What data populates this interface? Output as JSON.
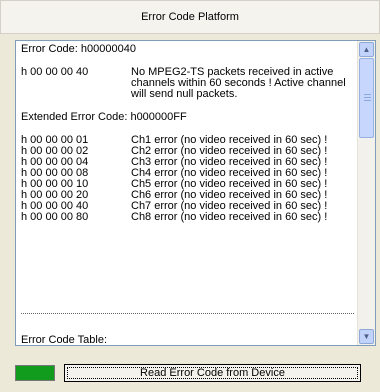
{
  "window": {
    "title": "Error Code Platform"
  },
  "output": {
    "error_code_line": "Error Code: h00000040",
    "main_code": {
      "code": "h 00 00 00 40",
      "message": [
        "No MPEG2-TS packets received in active",
        "channels within 60 seconds ! Active channel",
        "will send null packets."
      ]
    },
    "extended_line": "Extended Error Code: h000000FF",
    "channel_errors": [
      {
        "code": "h 00 00 00 01",
        "message": "Ch1 error (no video received in 60 sec) !"
      },
      {
        "code": "h 00 00 00 02",
        "message": "Ch2 error (no video received in 60 sec) !"
      },
      {
        "code": "h 00 00 00 04",
        "message": "Ch3 error (no video received in 60 sec) !"
      },
      {
        "code": "h 00 00 00 08",
        "message": "Ch4 error (no video received in 60 sec) !"
      },
      {
        "code": "h 00 00 00 10",
        "message": "Ch5 error (no video received in 60 sec) !"
      },
      {
        "code": "h 00 00 00 20",
        "message": "Ch6 error (no video received in 60 sec) !"
      },
      {
        "code": "h 00 00 00 40",
        "message": "Ch7 error (no video received in 60 sec) !"
      },
      {
        "code": "h 00 00 00 80",
        "message": "Ch8 error (no video received in 60 sec) !"
      }
    ],
    "table_label": "Error Code Table:"
  },
  "status": {
    "color": "#119c1d"
  },
  "buttons": {
    "read": "Read Error Code from Device"
  }
}
